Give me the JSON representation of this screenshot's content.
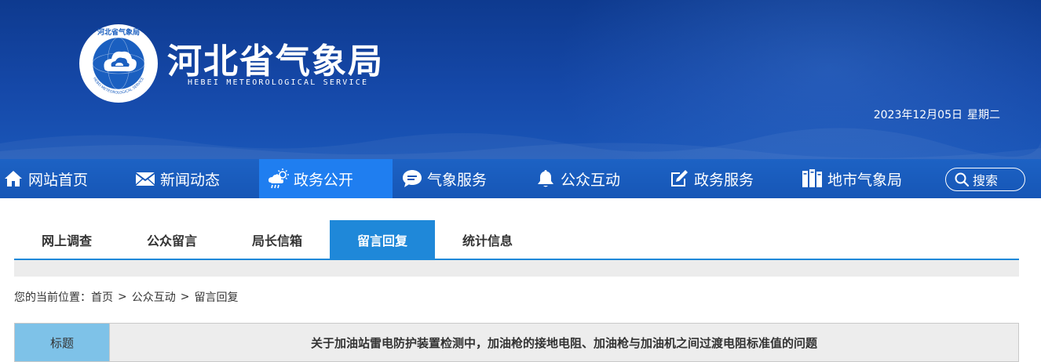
{
  "header": {
    "emblem_text": "河北省气象局",
    "emblem_subtext": "HEBEI METEOROLOGICAL SERVICE",
    "title": "河北省气象局",
    "subtitle": "HEBEI METEOROLOGICAL SERVICE",
    "date": "2023年12月05日",
    "weekday": "星期二"
  },
  "nav": {
    "items": [
      {
        "label": "网站首页",
        "icon": "home-icon"
      },
      {
        "label": "新闻动态",
        "icon": "envelope-icon"
      },
      {
        "label": "政务公开",
        "icon": "weather-icon",
        "active": true
      },
      {
        "label": "气象服务",
        "icon": "chat-bubble-icon"
      },
      {
        "label": "公众互动",
        "icon": "bell-icon"
      },
      {
        "label": "政务服务",
        "icon": "edit-icon"
      },
      {
        "label": "地市气象局",
        "icon": "books-icon"
      }
    ],
    "search_label": "搜索"
  },
  "subtabs": [
    {
      "label": "网上调查"
    },
    {
      "label": "公众留言"
    },
    {
      "label": "局长信箱"
    },
    {
      "label": "留言回复",
      "active": true
    },
    {
      "label": "统计信息"
    }
  ],
  "breadcrumb": {
    "prefix": "您的当前位置：",
    "items": [
      "首页",
      "公众互动",
      "留言回复"
    ],
    "separator": ">"
  },
  "table": {
    "header": "标题",
    "value": "关于加油站雷电防护装置检测中，加油枪的接地电阻、加油枪与加油机之间过渡电阻标准值的问题"
  },
  "colors": {
    "banner": "#1548a8",
    "nav": "#1656b6",
    "nav_active": "#1f7ef0",
    "subtab_active": "#1f88d9",
    "table_header": "#7ec2e8"
  }
}
